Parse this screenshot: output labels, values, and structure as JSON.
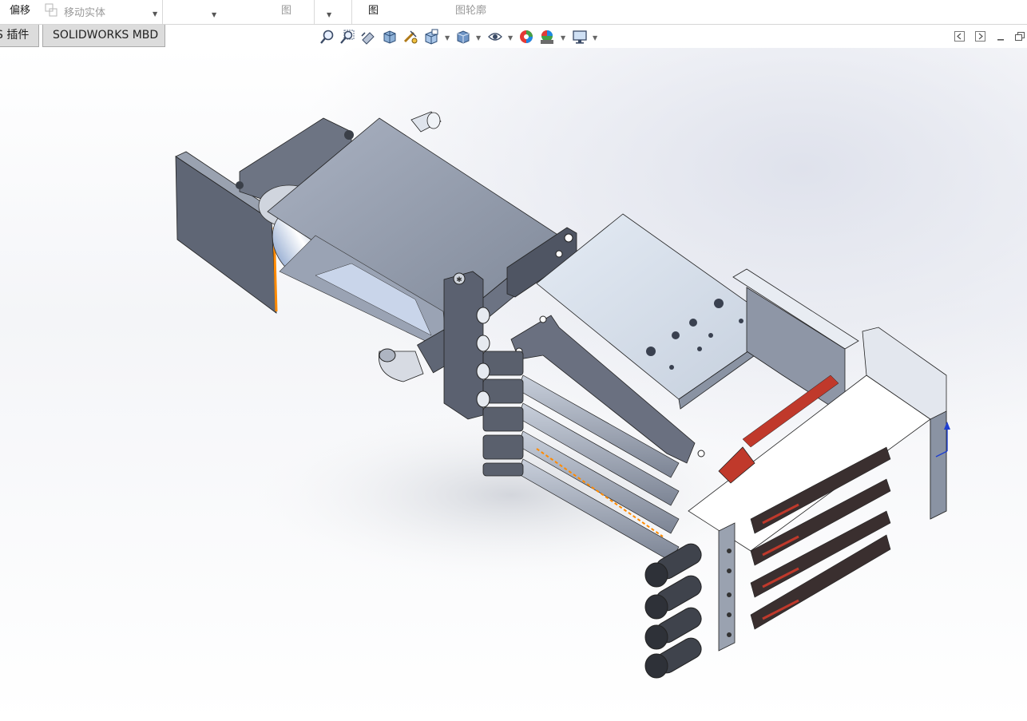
{
  "ribbon": {
    "offset_label": "偏移",
    "move_body_label": "移动实体",
    "view_label_1": "图",
    "view_label_2": "图",
    "profile_label": "图轮廓"
  },
  "tabs": [
    {
      "label": "S 插件"
    },
    {
      "label": "SOLIDWORKS MBD"
    }
  ],
  "view_toolbar": {
    "icons": [
      "zoom-to-fit-icon",
      "zoom-area-icon",
      "previous-view-icon",
      "section-view-icon",
      "dynamic-annotation-icon",
      "view-orientation-icon",
      "display-style-icon",
      "hide-show-items-icon",
      "edit-appearance-icon",
      "apply-scene-icon",
      "view-settings-icon"
    ]
  },
  "window_buttons": [
    "tile-left-icon",
    "tile-right-icon",
    "minimize-icon",
    "restore-icon"
  ],
  "colors": {
    "ribbon_bg": "#ffffff",
    "tab_bg": "#dcdcdc",
    "steel_dark": "#5f6675",
    "steel_mid": "#8e96a6",
    "steel_light": "#c9d0dc",
    "highlight_orange": "#ff8a00",
    "section_red": "#c0392b"
  }
}
